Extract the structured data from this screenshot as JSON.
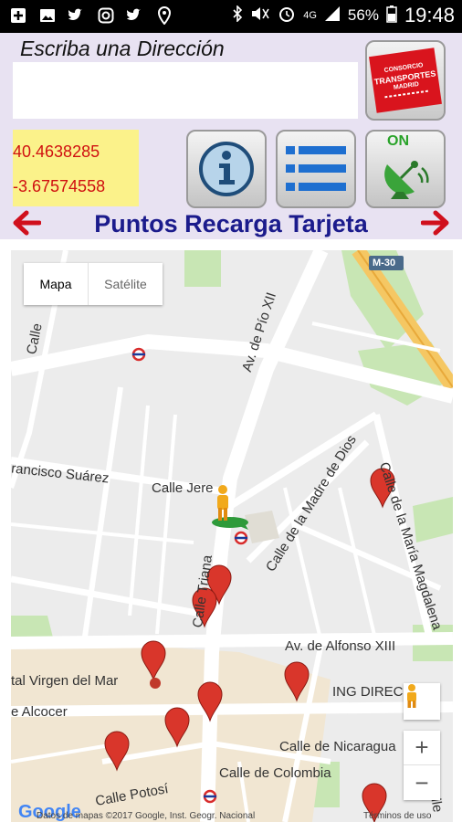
{
  "status_bar": {
    "network": "4G",
    "battery": "56%",
    "time": "19:48",
    "icons": [
      "plus-square-icon",
      "image-icon",
      "twitter-icon",
      "instagram-icon",
      "twitter-icon",
      "location-icon",
      "bluetooth-icon",
      "mute-icon",
      "alarm-icon",
      "signal-icon",
      "battery-icon"
    ]
  },
  "address": {
    "label": "Escriba una Dirección",
    "value": "",
    "placeholder": ""
  },
  "coords": {
    "lat": "40.4638285",
    "lon": "-3.67574558"
  },
  "logo": {
    "line1": "CONSORCIO",
    "line2": "TRANSPORTES",
    "line3": "MADRID"
  },
  "gps": {
    "state": "ON"
  },
  "title": "Puntos Recarga Tarjeta",
  "colors": {
    "title": "#1b1b8c",
    "arrow": "#d0101d",
    "pin": "#d9362b"
  },
  "map": {
    "type_buttons": [
      "Mapa",
      "Satélite"
    ],
    "zoom_in": "+",
    "zoom_out": "−",
    "labels": {
      "m30": "M-30",
      "pio_xii": "Av. de Pío XII",
      "francisco": "rancisco Suárez",
      "jeres": "Calle Jere",
      "madre": "Calle de la Madre de Dios",
      "maria": "Calle de la María Magdalena",
      "triana": "Calle Triana",
      "alfonso": "Av. de Alfonso XIII",
      "virgen": "tal Virgen del Mar",
      "alcocer": "e Alcocer",
      "ing": "ING DIREC",
      "nicaragua": "Calle de Nicaragua",
      "potosi": "Calle Potosí",
      "colombia": "Calle de Colombia",
      "calle_left": "Calle",
      "calle_right": "Calle"
    },
    "footer": {
      "google": "Google",
      "copyright": "Datos de mapas ©2017 Google, Inst. Geogr. Nacional",
      "terms": "Términos de uso"
    }
  }
}
